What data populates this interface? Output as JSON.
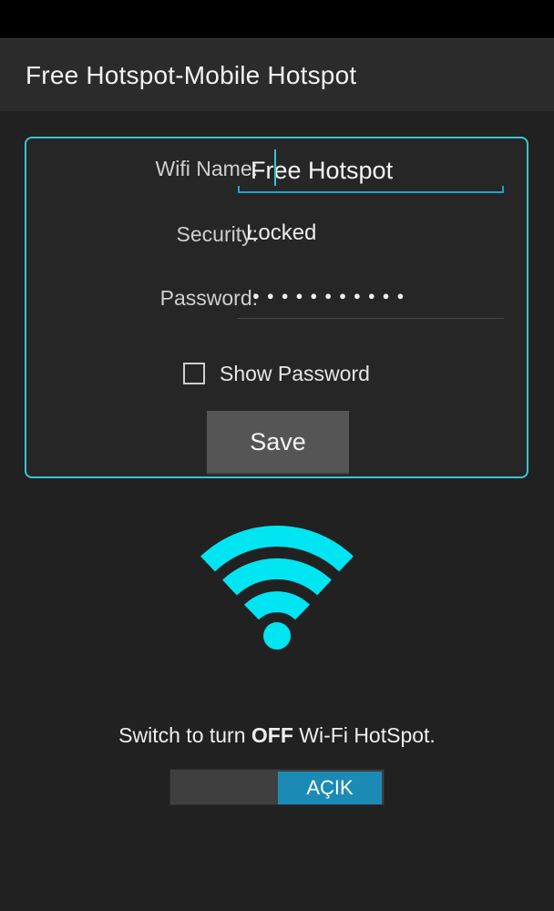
{
  "app": {
    "title": "Free Hotspot-Mobile Hotspot"
  },
  "form": {
    "wifi_name_label": "Wifi Name:",
    "wifi_name_value": "Free Hotspot",
    "security_label": "Security:",
    "security_value": "Locked",
    "password_label": "Password:",
    "password_mask": "●●●●●●●●●●●",
    "show_password_label": "Show Password",
    "show_password_checked": false,
    "save_label": "Save"
  },
  "hotspot": {
    "switch_caption_prefix": "Switch to turn ",
    "switch_caption_bold": "OFF",
    "switch_caption_suffix": " Wi-Fi HotSpot.",
    "toggle_label": "AÇIK",
    "toggle_on": true
  },
  "colors": {
    "accent": "#35c6d6",
    "wifi_icon": "#00e5f2",
    "toggle_on": "#1b8bb6",
    "background": "#212121"
  },
  "icons": {
    "wifi": "wifi-icon",
    "checkbox": "checkbox-icon"
  }
}
